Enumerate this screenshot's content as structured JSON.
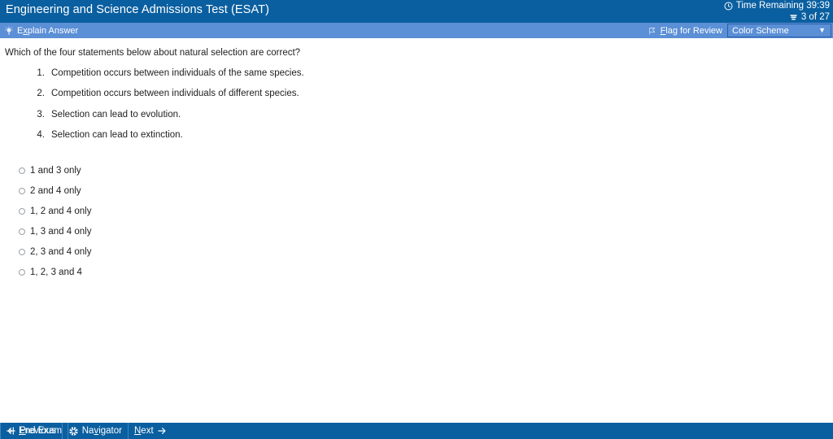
{
  "titlebar": {
    "title": "Engineering and Science Admissions Test (ESAT)",
    "timer_icon": "clock-icon",
    "timer_label": "Time Remaining 39:39",
    "progress_icon": "pages-icon",
    "progress_label": "3 of 27"
  },
  "toolbar": {
    "explain_icon": "lightbulb-icon",
    "explain_label_pre": "E",
    "explain_label_key": "x",
    "explain_label_post": "plain Answer",
    "explain_label_full": "Explain Answer",
    "flag_icon": "flag-icon",
    "flag_label_pre": "",
    "flag_label_key": "F",
    "flag_label_post": "lag for Review",
    "flag_label_full": "Flag for Review",
    "color_scheme_value": "Color Scheme",
    "color_scheme_caret": "▼"
  },
  "question": {
    "stem": "Which of the four statements below about natural selection are correct?",
    "statements": [
      {
        "num": "1.",
        "text": "Competition occurs between individuals of the same species."
      },
      {
        "num": "2.",
        "text": "Competition occurs between individuals of different species."
      },
      {
        "num": "3.",
        "text": "Selection can lead to evolution."
      },
      {
        "num": "4.",
        "text": "Selection can lead to extinction."
      }
    ],
    "options": [
      {
        "label": "1 and 3 only",
        "selected": false
      },
      {
        "label": "2 and 4 only",
        "selected": false
      },
      {
        "label": "1, 2 and 4 only",
        "selected": false
      },
      {
        "label": "1, 3 and 4 only",
        "selected": false
      },
      {
        "label": "2, 3 and 4 only",
        "selected": false
      },
      {
        "label": "1, 2, 3 and 4",
        "selected": false
      }
    ]
  },
  "footer": {
    "end_exam_icon": "exit-icon",
    "end_exam_key": "E",
    "end_exam_post": "nd Exam",
    "end_exam_full": "End Exam",
    "previous_icon": "arrow-left-icon",
    "previous_key": "P",
    "previous_post": "revious",
    "previous_full": "Previous",
    "navigator_icon": "compass-icon",
    "navigator_pre": "Na",
    "navigator_key": "v",
    "navigator_post": "igator",
    "navigator_full": "Navigator",
    "next_key": "N",
    "next_post": "ext",
    "next_full": "Next",
    "next_icon": "arrow-right-icon"
  },
  "colors": {
    "header_blue": "#0A5FA0",
    "toolbar_blue": "#5B8FD6",
    "content_bg": "#ffffff",
    "text": "#222222"
  }
}
